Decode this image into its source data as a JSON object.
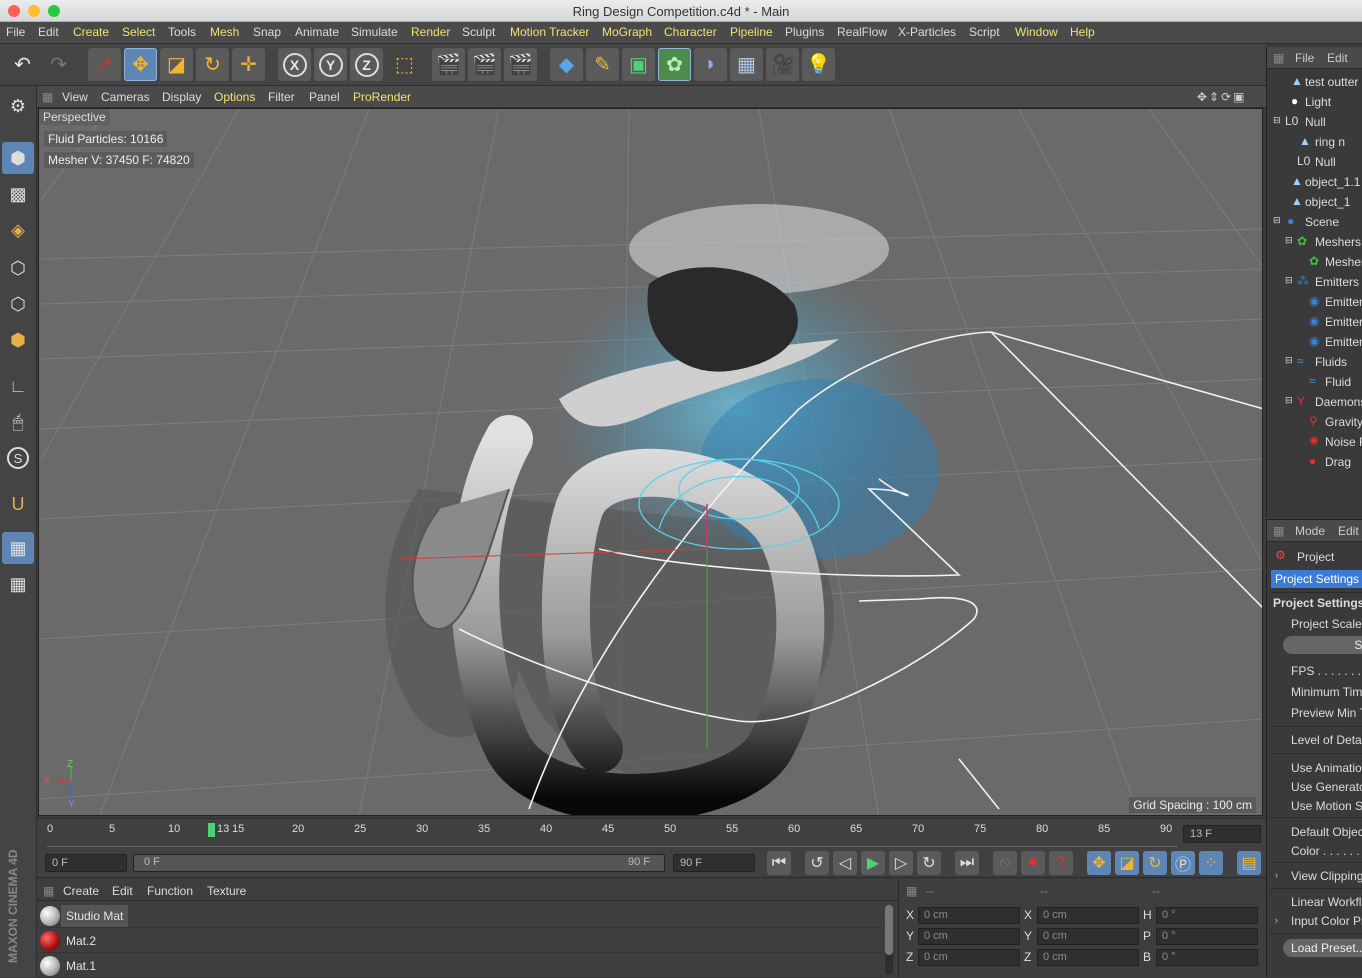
{
  "window": {
    "title": "Ring Design Competition.c4d * - Main",
    "traffic_light_colors": [
      "#fe5f57",
      "#febc2e",
      "#28c840"
    ]
  },
  "menubar": {
    "items": [
      {
        "label": "File",
        "highlight": false
      },
      {
        "label": "Edit",
        "highlight": false
      },
      {
        "label": "Create",
        "highlight": true
      },
      {
        "label": "Select",
        "highlight": true
      },
      {
        "label": "Tools",
        "highlight": false
      },
      {
        "label": "Mesh",
        "highlight": true
      },
      {
        "label": "Snap",
        "highlight": false
      },
      {
        "label": "Animate",
        "highlight": false
      },
      {
        "label": "Simulate",
        "highlight": false
      },
      {
        "label": "Render",
        "highlight": true
      },
      {
        "label": "Sculpt",
        "highlight": false
      },
      {
        "label": "Motion Tracker",
        "highlight": true
      },
      {
        "label": "MoGraph",
        "highlight": true
      },
      {
        "label": "Character",
        "highlight": true
      },
      {
        "label": "Pipeline",
        "highlight": true
      },
      {
        "label": "Plugins",
        "highlight": false
      },
      {
        "label": "RealFlow",
        "highlight": false
      },
      {
        "label": "X-Particles",
        "highlight": false
      },
      {
        "label": "Script",
        "highlight": false
      },
      {
        "label": "Window",
        "highlight": true
      },
      {
        "label": "Help",
        "highlight": true
      }
    ],
    "accent_color": "#f3e171"
  },
  "toolbar": {
    "undo_icon": "undo-icon",
    "redo_icon": "redo-icon",
    "x_axis": "X",
    "y_axis": "Y",
    "z_axis": "Z"
  },
  "viewport": {
    "menu": [
      {
        "label": "View",
        "highlight": false
      },
      {
        "label": "Cameras",
        "highlight": false
      },
      {
        "label": "Display",
        "highlight": false
      },
      {
        "label": "Options",
        "highlight": true
      },
      {
        "label": "Filter",
        "highlight": false
      },
      {
        "label": "Panel",
        "highlight": false
      },
      {
        "label": "ProRender",
        "highlight": true
      }
    ],
    "camera_label": "Perspective",
    "fluid_particles": "Fluid  Particles: 10166",
    "mesher_stats": "Mesher  V: 37450  F: 74820",
    "grid_spacing": "Grid Spacing : 100 cm",
    "axis_labels": {
      "x": "X",
      "y": "Y",
      "z": "Z"
    }
  },
  "timeline": {
    "ticks": [
      "0",
      "5",
      "10",
      "13",
      "15",
      "20",
      "25",
      "30",
      "35",
      "40",
      "45",
      "50",
      "55",
      "60",
      "65",
      "70",
      "75",
      "80",
      "85",
      "90"
    ],
    "current_frame_marker": "13",
    "current_frame_field": "13 F",
    "playhead_color": "#4cd17a"
  },
  "transport": {
    "start_field": "0 F",
    "range_start": "0 F",
    "range_end": "90 F",
    "end_field": "90 F"
  },
  "materials": {
    "menu": [
      "Create",
      "Edit",
      "Function",
      "Texture"
    ],
    "items": [
      {
        "name": "Studio Mat",
        "color": "#cfcfcf"
      },
      {
        "name": "Mat.2",
        "color": "#b01515"
      },
      {
        "name": "Mat.1",
        "color": "#cfcfcf"
      }
    ],
    "brand": "MAXON CINEMA 4D"
  },
  "coordinates": {
    "header": [
      "--",
      "--",
      "--"
    ],
    "rows": [
      {
        "l1": "X",
        "v1": "0 cm",
        "l2": "X",
        "v2": "0 cm",
        "l3": "H",
        "v3": "0 °"
      },
      {
        "l1": "Y",
        "v1": "0 cm",
        "l2": "Y",
        "v2": "0 cm",
        "l3": "P",
        "v3": "0 °"
      },
      {
        "l1": "Z",
        "v1": "0 cm",
        "l2": "Z",
        "v2": "0 cm",
        "l3": "B",
        "v3": "0 °"
      }
    ]
  },
  "object_manager": {
    "menu": [
      "File",
      "Edit"
    ],
    "objects": [
      {
        "label": "test outter",
        "icon": "polygon-object-icon",
        "color": "#9fd0ff"
      },
      {
        "label": "Light",
        "icon": "light-icon",
        "color": "#ffffff"
      },
      {
        "label": "Null",
        "icon": "null-icon",
        "color": "#dddddd"
      },
      {
        "label": "ring n",
        "icon": "polygon-object-icon",
        "color": "#9fd0ff"
      },
      {
        "label": "Null",
        "icon": "null-icon",
        "color": "#dddddd"
      },
      {
        "label": "object_1.1",
        "icon": "polygon-object-icon",
        "color": "#9fd0ff"
      },
      {
        "label": "object_1",
        "icon": "polygon-object-icon",
        "color": "#9fd0ff"
      },
      {
        "label": "Scene",
        "icon": "scene-icon",
        "color": "#3b7fd8"
      },
      {
        "label": "Meshers",
        "icon": "mesher-icon",
        "color": "#3fbf3f"
      },
      {
        "label": "Mesher",
        "icon": "mesher-icon",
        "color": "#3fbf3f"
      },
      {
        "label": "Emitters",
        "icon": "emitter-group-icon",
        "color": "#3b7fd8"
      },
      {
        "label": "Emitter",
        "icon": "emitter-icon",
        "color": "#3b7fd8"
      },
      {
        "label": "Emitter",
        "icon": "emitter-icon",
        "color": "#3b7fd8"
      },
      {
        "label": "Emitter",
        "icon": "emitter-icon",
        "color": "#3b7fd8"
      },
      {
        "label": "Fluids",
        "icon": "fluids-icon",
        "color": "#3b9fd8"
      },
      {
        "label": "Fluid",
        "icon": "fluid-icon",
        "color": "#3b9fd8"
      },
      {
        "label": "Daemons",
        "icon": "daemons-icon",
        "color": "#e03030"
      },
      {
        "label": "Gravity",
        "icon": "gravity-icon",
        "color": "#e03030"
      },
      {
        "label": "Noise F",
        "icon": "noise-icon",
        "color": "#e03030"
      },
      {
        "label": "Drag",
        "icon": "drag-icon",
        "color": "#e03030"
      }
    ]
  },
  "attribute_manager": {
    "menu": [
      "Mode",
      "Edit"
    ],
    "project_label": "Project",
    "tab": "Project Settings",
    "section_title": "Project Settings",
    "scale_label": "Project Scale .",
    "scale_button": "Sca",
    "fps": "FPS . . . . . . . . .",
    "min_time": "Minimum Time",
    "preview_min": "Preview Min T",
    "level_of_detail": "Level of Detail",
    "use_animation": "Use Animation",
    "use_generators": "Use Generator",
    "use_motion": "Use Motion Sy",
    "default_object": "Default Object",
    "color": "Color . . . . . .",
    "view_clipping": "View Clipping",
    "linear_workflow": "Linear Workflo",
    "input_color": "Input Color Pr",
    "load_preset": "Load Preset...",
    "tab_color": "#3a7bd5"
  }
}
